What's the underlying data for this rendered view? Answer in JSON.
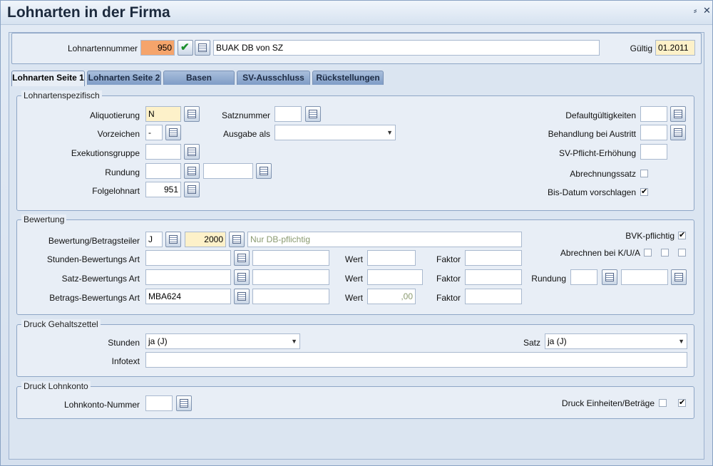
{
  "window": {
    "title": "Lohnarten in der Firma",
    "pin_glyph": "⸗",
    "close_glyph": "✕"
  },
  "header": {
    "number_label": "Lohnartennummer",
    "number_value": "950",
    "name_value": "BUAK DB von SZ",
    "valid_label": "Gültig",
    "valid_value": "01.2011"
  },
  "tabs": [
    {
      "label": "Lohnarten Seite 1",
      "active": true
    },
    {
      "label": "Lohnarten Seite 2"
    },
    {
      "label": "Basen"
    },
    {
      "label": "SV-Ausschluss"
    },
    {
      "label": "Rückstellungen"
    }
  ],
  "lohnartenspezifisch": {
    "legend": "Lohnartenspezifisch",
    "aliquotierung_label": "Aliquotierung",
    "aliquotierung_value": "N",
    "vorzeichen_label": "Vorzeichen",
    "vorzeichen_value": "-",
    "exekutionsgruppe_label": "Exekutionsgruppe",
    "exekutionsgruppe_value": "",
    "rundung_label": "Rundung",
    "rundung_value1": "",
    "rundung_value2": "",
    "folgelohnart_label": "Folgelohnart",
    "folgelohnart_value": "951",
    "satznummer_label": "Satznummer",
    "satznummer_value": "",
    "ausgabe_label": "Ausgabe als",
    "ausgabe_value": "",
    "defaultgueltig_label": "Defaultgültigkeiten",
    "defaultgueltig_value": "",
    "austritt_label": "Behandlung bei Austritt",
    "austritt_value": "",
    "svpflicht_label": "SV-Pflicht-Erhöhung",
    "svpflicht_value": "",
    "abrechnungssatz_label": "Abrechnungssatz",
    "abrechnungssatz_checked": false,
    "bisdatum_label": "Bis-Datum vorschlagen",
    "bisdatum_checked": true
  },
  "bewertung": {
    "legend": "Bewertung",
    "betragsteiler_label": "Bewertung/Betragsteiler",
    "betragsteiler_value": "J",
    "betragsteiler_amount": "2000",
    "betragsteiler_text": "Nur DB-pflichtig",
    "stunden_label": "Stunden-Bewertungs Art",
    "stunden_value": "",
    "stunden_text": "",
    "satz_label": "Satz-Bewertungs Art",
    "satz_value": "",
    "satz_text": "",
    "betrags_label": "Betrags-Bewertungs Art",
    "betrags_value": "MBA624",
    "betrags_text": "",
    "wert_label": "Wert",
    "faktor_label": "Faktor",
    "wert1": "",
    "wert2": "",
    "wert3": ",00",
    "faktor1": "",
    "faktor2": "",
    "faktor3": "",
    "bvk_label": "BVK-pflichtig",
    "bvk_checked": true,
    "kua_label": "Abrechnen bei K/U/A",
    "rundung_label": "Rundung",
    "rundung_value1": "",
    "rundung_value2": ""
  },
  "druck_gehalt": {
    "legend": "Druck Gehaltszettel",
    "stunden_label": "Stunden",
    "stunden_value": "ja (J)",
    "satz_label": "Satz",
    "satz_value": "ja (J)",
    "infotext_label": "Infotext",
    "infotext_value": ""
  },
  "druck_lohnkonto": {
    "legend": "Druck Lohnkonto",
    "nummer_label": "Lohnkonto-Nummer",
    "nummer_value": "",
    "einheiten_label": "Druck Einheiten/Beträge",
    "einheiten_checked": false,
    "betraege_checked": true
  },
  "glyphs": {
    "check": "✔",
    "arrow": "▼",
    "ok_icon": "✔"
  }
}
